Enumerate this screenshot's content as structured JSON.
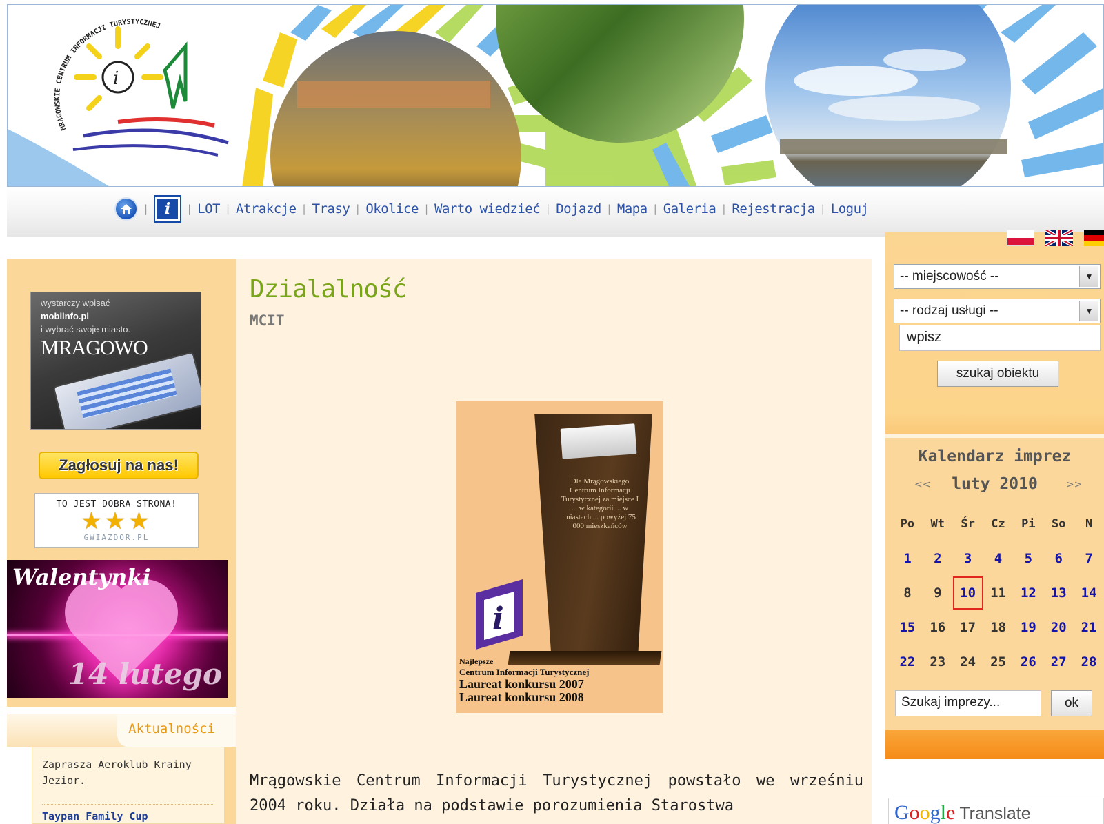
{
  "header": {
    "logo_text": "MRĄGOWSKIE CENTRUM INFORMACJI TURYSTYCZNEJ",
    "logo_icon": "info-sun-sail-logo"
  },
  "nav": {
    "home_icon": "home-icon",
    "info_icon_label": "i",
    "items": [
      {
        "label": "LOT"
      },
      {
        "label": "Atrakcje"
      },
      {
        "label": "Trasy"
      },
      {
        "label": "Okolice"
      },
      {
        "label": "Warto wiedzieć"
      },
      {
        "label": "Dojazd"
      },
      {
        "label": "Mapa"
      },
      {
        "label": "Galeria"
      },
      {
        "label": "Rejestracja"
      },
      {
        "label": "Loguj"
      }
    ]
  },
  "left": {
    "mobi_ad": {
      "line1": "wystarczy wpisać",
      "line2": "mobiinfo.pl",
      "line3": "i wybrać swoje miasto.",
      "city": "MRAGOWO"
    },
    "vote_button": "Zagłosuj na nas!",
    "gwiazdor": {
      "title": "TO JEST DOBRA STRONA!",
      "stars": "★★★",
      "site": "GWIAZDOR.PL"
    },
    "valentine": {
      "title": "Walentynki",
      "date": "14 lutego"
    },
    "news": {
      "heading": "Aktualności",
      "items": [
        {
          "text": "Zaprasza Aeroklub Krainy Jezior."
        },
        {
          "text": "Taypan Family Cup"
        }
      ]
    }
  },
  "main": {
    "title": "Dzialalność",
    "subtitle": "MCIT",
    "award": {
      "trophy_text": "Dla Mrągowskiego Centrum Informacji Turystycznej za miejsce I ... w kategorii ... w miastach ... powyżej 75 000 mieszkańców",
      "caption1": "Najlepsze",
      "caption2": "Centrum Informacji Turystycznej",
      "caption3": "Laureat konkursu 2007",
      "caption4": "Laureat konkursu 2008"
    },
    "body": "Mrągowskie Centrum Informacji Turystycznej powstało we wrześniu 2004 roku. Działa na podstawie porozumienia Starostwa"
  },
  "right": {
    "flags": [
      "flag-pl",
      "flag-gb",
      "flag-de"
    ],
    "select_place": "-- miejscowość --",
    "select_service": "-- rodzaj usługi --",
    "search_value": "wpisz",
    "search_button": "szukaj obiektu",
    "calendar": {
      "title": "Kalendarz imprez",
      "prev": "<<",
      "next": ">>",
      "month": "luty 2010",
      "weekdays": [
        "Po",
        "Wt",
        "Śr",
        "Cz",
        "Pi",
        "So",
        "N"
      ],
      "weeks": [
        [
          {
            "d": "1",
            "ev": true
          },
          {
            "d": "2",
            "ev": true
          },
          {
            "d": "3",
            "ev": true
          },
          {
            "d": "4",
            "ev": true
          },
          {
            "d": "5",
            "ev": true
          },
          {
            "d": "6",
            "ev": true
          },
          {
            "d": "7",
            "ev": true
          }
        ],
        [
          {
            "d": "8",
            "ev": false
          },
          {
            "d": "9",
            "ev": false
          },
          {
            "d": "10",
            "ev": true,
            "today": true
          },
          {
            "d": "11",
            "ev": false
          },
          {
            "d": "12",
            "ev": true
          },
          {
            "d": "13",
            "ev": true
          },
          {
            "d": "14",
            "ev": true
          }
        ],
        [
          {
            "d": "15",
            "ev": true
          },
          {
            "d": "16",
            "ev": false
          },
          {
            "d": "17",
            "ev": false
          },
          {
            "d": "18",
            "ev": false
          },
          {
            "d": "19",
            "ev": true
          },
          {
            "d": "20",
            "ev": true
          },
          {
            "d": "21",
            "ev": true
          }
        ],
        [
          {
            "d": "22",
            "ev": true
          },
          {
            "d": "23",
            "ev": false
          },
          {
            "d": "24",
            "ev": false
          },
          {
            "d": "25",
            "ev": false
          },
          {
            "d": "26",
            "ev": true
          },
          {
            "d": "27",
            "ev": true
          },
          {
            "d": "28",
            "ev": true
          }
        ]
      ],
      "search_placeholder": "Szukaj imprezy...",
      "ok_button": "ok"
    },
    "translate": {
      "g1": "G",
      "o1": "o",
      "o2": "o",
      "g2": "g",
      "l": "l",
      "e": "e",
      "word": "Translate"
    }
  },
  "colors": {
    "accent_orange": "#fbd89a",
    "title_green": "#7aa51a",
    "link_blue": "#2c53a8",
    "event_blue": "#1414a8",
    "today_red": "#e0261f"
  }
}
